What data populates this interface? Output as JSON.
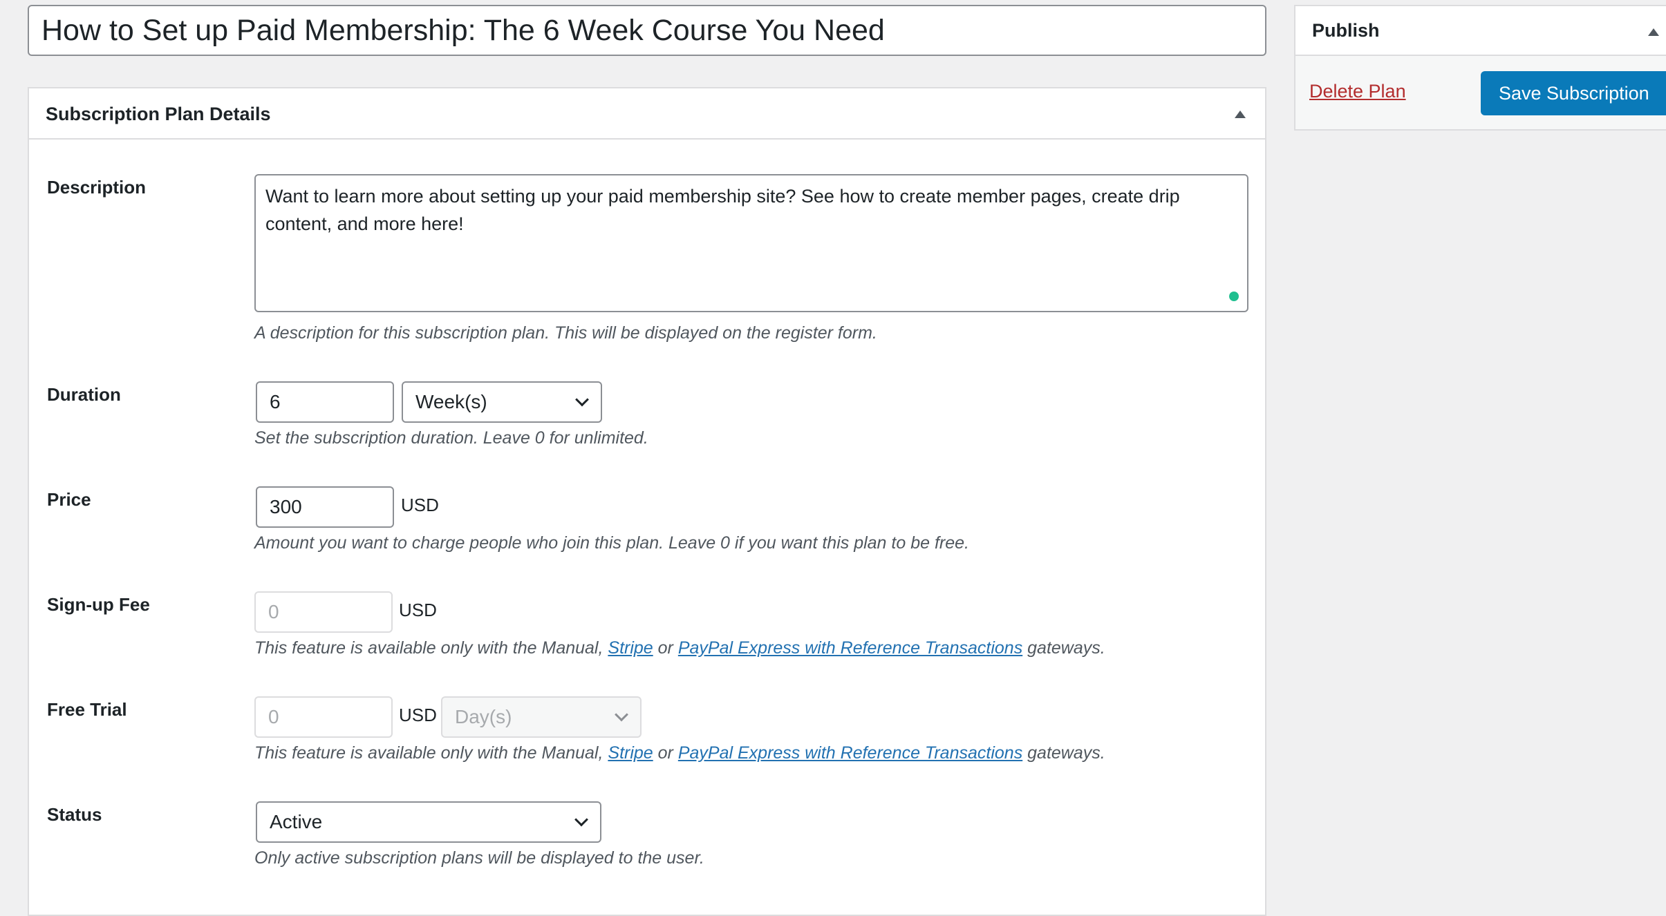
{
  "title": "How to Set up Paid Membership: The 6 Week Course You Need",
  "panel": {
    "heading": "Subscription Plan Details"
  },
  "fields": {
    "description": {
      "label": "Description",
      "value": "Want to learn more about setting up your paid membership site? See how to create member pages, create drip content, and more here!",
      "help": "A description for this subscription plan. This will be displayed on the register form."
    },
    "duration": {
      "label": "Duration",
      "value": "6",
      "unit": "Week(s)",
      "help": "Set the subscription duration. Leave 0 for unlimited."
    },
    "price": {
      "label": "Price",
      "value": "300",
      "currency": "USD",
      "help": "Amount you want to charge people who join this plan. Leave 0 if you want this plan to be free."
    },
    "signup_fee": {
      "label": "Sign-up Fee",
      "value": "0",
      "currency": "USD",
      "help_pre": "This feature is available only with the Manual, ",
      "link1": "Stripe",
      "help_mid": " or ",
      "link2": "PayPal Express with Reference Transactions",
      "help_post": " gateways."
    },
    "free_trial": {
      "label": "Free Trial",
      "value": "0",
      "currency": "USD",
      "unit": "Day(s)",
      "help_pre": "This feature is available only with the Manual, ",
      "link1": "Stripe",
      "help_mid": " or ",
      "link2": "PayPal Express with Reference Transactions",
      "help_post": " gateways."
    },
    "status": {
      "label": "Status",
      "value": "Active",
      "help": "Only active subscription plans will be displayed to the user."
    }
  },
  "publish": {
    "heading": "Publish",
    "delete": "Delete Plan",
    "save": "Save Subscription"
  },
  "colors": {
    "primary": "#2271b1",
    "button": "#0a7ab9",
    "delete": "#b32d2e"
  }
}
